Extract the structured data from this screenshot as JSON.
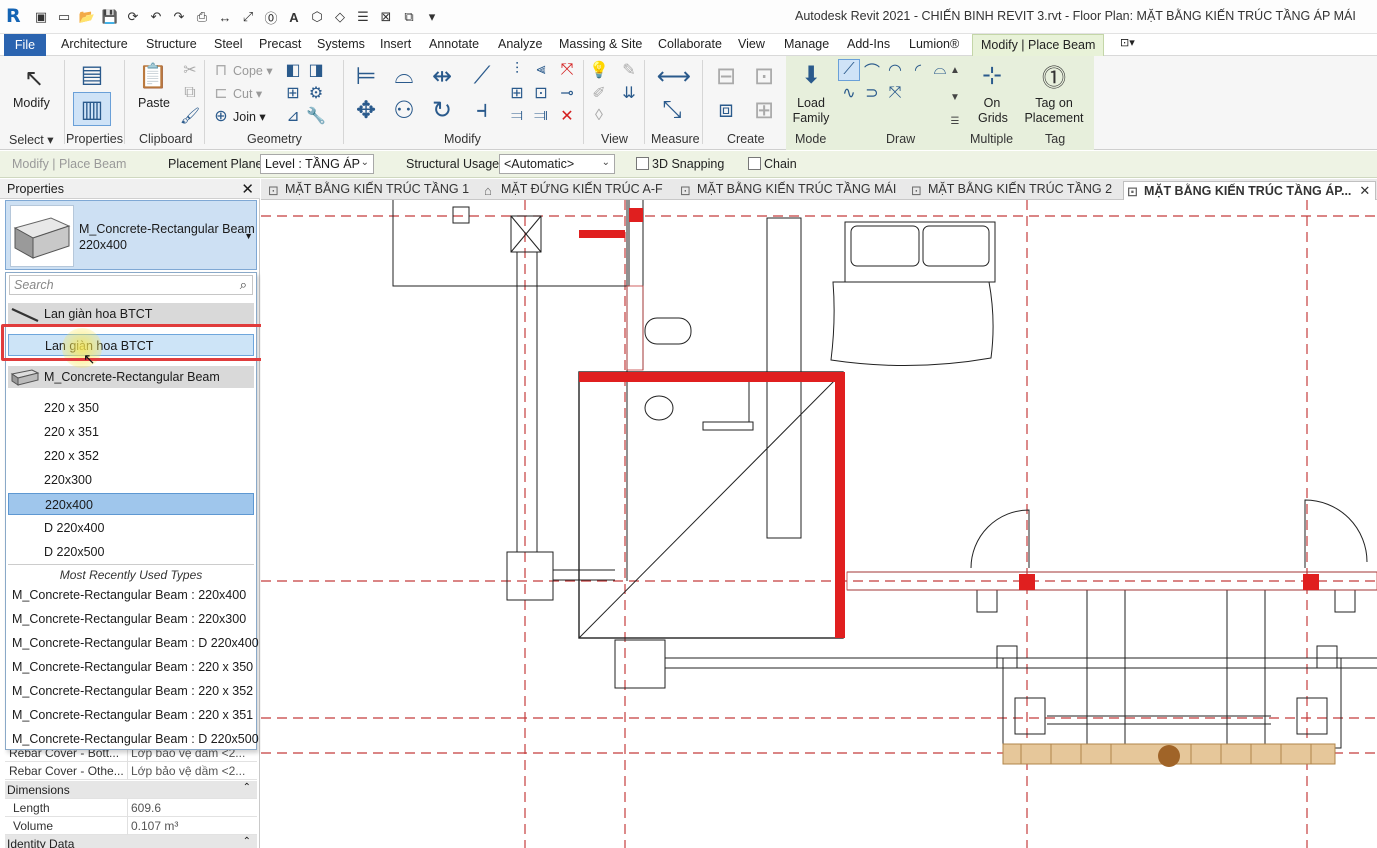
{
  "app": {
    "title": "Autodesk Revit 2021 - CHIẾN BINH REVIT 3.rvt - Floor Plan: MẶT BẰNG KIẾN TRÚC TẦNG ÁP MÁI"
  },
  "ribbon_tabs": [
    "File",
    "Architecture",
    "Structure",
    "Steel",
    "Precast",
    "Systems",
    "Insert",
    "Annotate",
    "Analyze",
    "Massing & Site",
    "Collaborate",
    "View",
    "Manage",
    "Add-Ins",
    "Lumion®",
    "Modify | Place Beam"
  ],
  "ribbon": {
    "modify_label": "Modify",
    "paste_label": "Paste",
    "cope_label": "Cope",
    "cut_label": "Cut",
    "join_label": "Join",
    "load_family_label": "Load Family",
    "on_grids_label": "On Grids",
    "tag_on_placement_label": "Tag on Placement",
    "groups": {
      "select": "Select",
      "properties": "Properties",
      "clipboard": "Clipboard",
      "geometry": "Geometry",
      "modify": "Modify",
      "view": "View",
      "measure": "Measure",
      "create": "Create",
      "mode": "Mode",
      "draw": "Draw",
      "multiple": "Multiple",
      "tag": "Tag"
    }
  },
  "options_bar": {
    "context": "Modify | Place Beam",
    "placement_plane_label": "Placement Plane:",
    "placement_plane_value": "Level : TẦNG ÁP",
    "structural_usage_label": "Structural Usage:",
    "structural_usage_value": "<Automatic>",
    "snapping_label": "3D Snapping",
    "chain_label": "Chain"
  },
  "properties": {
    "title": "Properties",
    "type_name": "M_Concrete-Rectangular Beam",
    "type_size": "220x400",
    "search_placeholder": "Search",
    "family_1": "Lan giàn hoa BTCT",
    "family_1_type": "Lan giàn hoa BTCT",
    "family_2": "M_Concrete-Rectangular Beam",
    "types": [
      "220 x 350",
      "220 x 351",
      "220 x 352",
      "220x300",
      "220x400",
      "D 220x400",
      "D 220x500"
    ],
    "mru_header": "Most Recently Used Types",
    "mru": [
      "M_Concrete-Rectangular Beam : 220x400",
      "M_Concrete-Rectangular Beam : 220x300",
      "M_Concrete-Rectangular Beam : D 220x400",
      "M_Concrete-Rectangular Beam : 220 x 350",
      "M_Concrete-Rectangular Beam : 220 x 352",
      "M_Concrete-Rectangular Beam : 220 x 351",
      "M_Concrete-Rectangular Beam : D 220x500"
    ],
    "rows": {
      "rebar_bottom_k": "Rebar Cover - Bott...",
      "rebar_bottom_v": "Lớp bảo vệ dầm <2...",
      "rebar_other_k": "Rebar Cover - Othe...",
      "rebar_other_v": "Lớp bảo vệ dầm <2...",
      "dimensions": "Dimensions",
      "length_k": "Length",
      "length_v": "609.6",
      "volume_k": "Volume",
      "volume_v": "0.107 m³",
      "identity": "Identity Data"
    }
  },
  "view_tabs": [
    "MẶT BẰNG KIẾN TRÚC TẦNG 1",
    "MẶT ĐỨNG KIẾN TRÚC A-F",
    "MẶT BẰNG KIẾN TRÚC TẦNG MÁI",
    "MẶT BẰNG KIẾN TRÚC TẦNG 2",
    "MẶT BẰNG KIẾN TRÚC TẦNG ÁP..."
  ],
  "colors": {
    "accent": "#2b64b0",
    "beam_red": "#e01f1f",
    "grid_red": "#c0392b",
    "context_green": "#e7efdc"
  }
}
